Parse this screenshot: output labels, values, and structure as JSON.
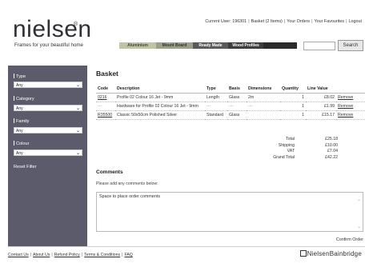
{
  "header": {
    "logo": "nielsen",
    "reg_mark": "®",
    "tagline": "Frames for your beautiful home",
    "top_nav": [
      "Current User:  196301",
      "Basket (2 Items)",
      "Your Orders",
      "Your Favourites",
      "Logout"
    ],
    "categories": [
      "Aluminium",
      "Mount Board",
      "Ready Made",
      "Wood Profiles"
    ],
    "search_button": "Search"
  },
  "sidebar": {
    "filters": [
      {
        "label": "Type",
        "value": "Any"
      },
      {
        "label": "Category",
        "value": "Any"
      },
      {
        "label": "Family",
        "value": "Any"
      },
      {
        "label": "Colour",
        "value": "Any"
      }
    ],
    "reset": "Reset Filter"
  },
  "basket": {
    "title": "Basket",
    "columns": [
      "Code",
      "Description",
      "Type",
      "Basis",
      "Dimensions",
      "Quantity",
      "Line Value",
      ""
    ],
    "rows": [
      {
        "code": "0216",
        "description": "Profile 02 Colour 16 Jet - 9mm",
        "type": "Length",
        "basis": "Glass",
        "dimensions": "2m",
        "quantity": "1",
        "value": "£8.02",
        "action": "Remove"
      },
      {
        "code": "---",
        "description": "Hardware for Profile 02 Colour 16 Jet - 9mm",
        "type": "---",
        "basis": "---",
        "dimensions": "---",
        "quantity": "1",
        "value": "£1.99",
        "action": "Remove"
      },
      {
        "code": "R35500",
        "description": "Classic 50x50cm Polished Silver",
        "type": "Standard",
        "basis": "Glass",
        "dimensions": "",
        "quantity": "1",
        "value": "£15.17",
        "action": "Remove"
      }
    ],
    "totals": [
      {
        "label": "Total",
        "value": "£25.18"
      },
      {
        "label": "Shipping",
        "value": "£10.00"
      },
      {
        "label": "VAT",
        "value": "£7.04"
      },
      {
        "label": "Grand Total",
        "value": "£42.22"
      }
    ]
  },
  "comments": {
    "title": "Comments",
    "help": "Please add any comments below:",
    "value": "Space to place order comments"
  },
  "confirm": "Confirm Order",
  "footer": {
    "links": [
      "Contact Us",
      "About Us",
      "Refund Policy",
      "Terms & Conditions",
      "FAQ"
    ],
    "brand": "NielsenBainbridge"
  }
}
